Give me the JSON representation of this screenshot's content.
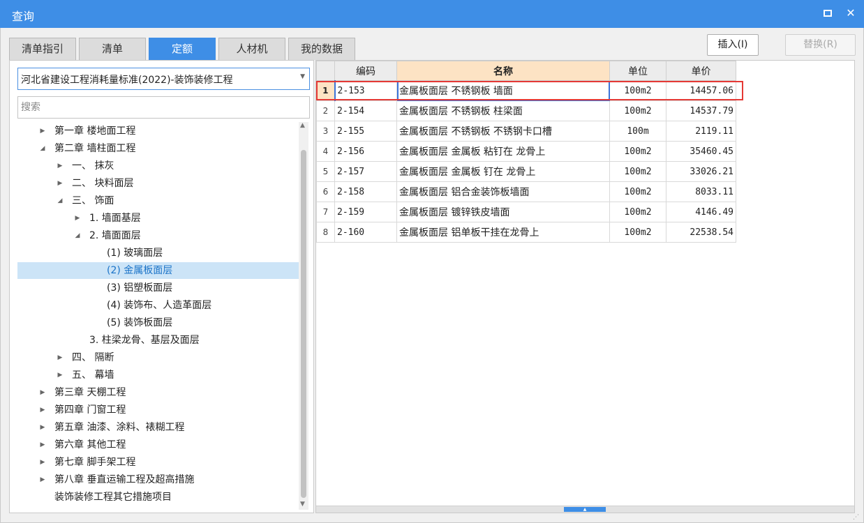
{
  "window": {
    "title": "查询"
  },
  "tabs": [
    "清单指引",
    "清单",
    "定额",
    "人材机",
    "我的数据"
  ],
  "actions": {
    "insert": "插入(I)",
    "replace": "替换(R)"
  },
  "left": {
    "standard": "河北省建设工程消耗量标准(2022)-装饰装修工程",
    "search_placeholder": "搜索",
    "tree": [
      {
        "label": "第一章 楼地面工程"
      },
      {
        "label": "第二章 墙柱面工程"
      },
      {
        "label": "一、 抹灰"
      },
      {
        "label": "二、 块料面层"
      },
      {
        "label": "三、 饰面"
      },
      {
        "label": "1. 墙面基层"
      },
      {
        "label": "2. 墙面面层"
      },
      {
        "label": "(1) 玻璃面层"
      },
      {
        "label": "(2) 金属板面层"
      },
      {
        "label": "(3) 铝塑板面层"
      },
      {
        "label": "(4) 装饰布、人造革面层"
      },
      {
        "label": "(5) 装饰板面层"
      },
      {
        "label": "3. 柱梁龙骨、基层及面层"
      },
      {
        "label": "四、 隔断"
      },
      {
        "label": "五、 幕墙"
      },
      {
        "label": "第三章 天棚工程"
      },
      {
        "label": "第四章 门窗工程"
      },
      {
        "label": "第五章 油漆、涂料、裱糊工程"
      },
      {
        "label": "第六章 其他工程"
      },
      {
        "label": "第七章 脚手架工程"
      },
      {
        "label": "第八章 垂直运输工程及超高措施"
      },
      {
        "label": "装饰装修工程其它措施项目"
      }
    ]
  },
  "table": {
    "columns": [
      "编码",
      "名称",
      "单位",
      "单价"
    ],
    "rows": [
      {
        "num": "1",
        "code": "2-153",
        "name": "金属板面层 不锈钢板 墙面",
        "unit": "100m2",
        "price": "14457.06"
      },
      {
        "num": "2",
        "code": "2-154",
        "name": "金属板面层 不锈钢板 柱梁面",
        "unit": "100m2",
        "price": "14537.79"
      },
      {
        "num": "3",
        "code": "2-155",
        "name": "金属板面层 不锈钢板 不锈钢卡口槽",
        "unit": "100m",
        "price": "2119.11"
      },
      {
        "num": "4",
        "code": "2-156",
        "name": "金属板面层 金属板 粘钉在 龙骨上",
        "unit": "100m2",
        "price": "35460.45"
      },
      {
        "num": "5",
        "code": "2-157",
        "name": "金属板面层 金属板 钉在 龙骨上",
        "unit": "100m2",
        "price": "33026.21"
      },
      {
        "num": "6",
        "code": "2-158",
        "name": "金属板面层 铝合金装饰板墙面",
        "unit": "100m2",
        "price": "8033.11"
      },
      {
        "num": "7",
        "code": "2-159",
        "name": "金属板面层 镀锌铁皮墙面",
        "unit": "100m2",
        "price": "4146.49"
      },
      {
        "num": "8",
        "code": "2-160",
        "name": "金属板面层 铝单板干挂在龙骨上",
        "unit": "100m2",
        "price": "22538.54"
      }
    ]
  }
}
